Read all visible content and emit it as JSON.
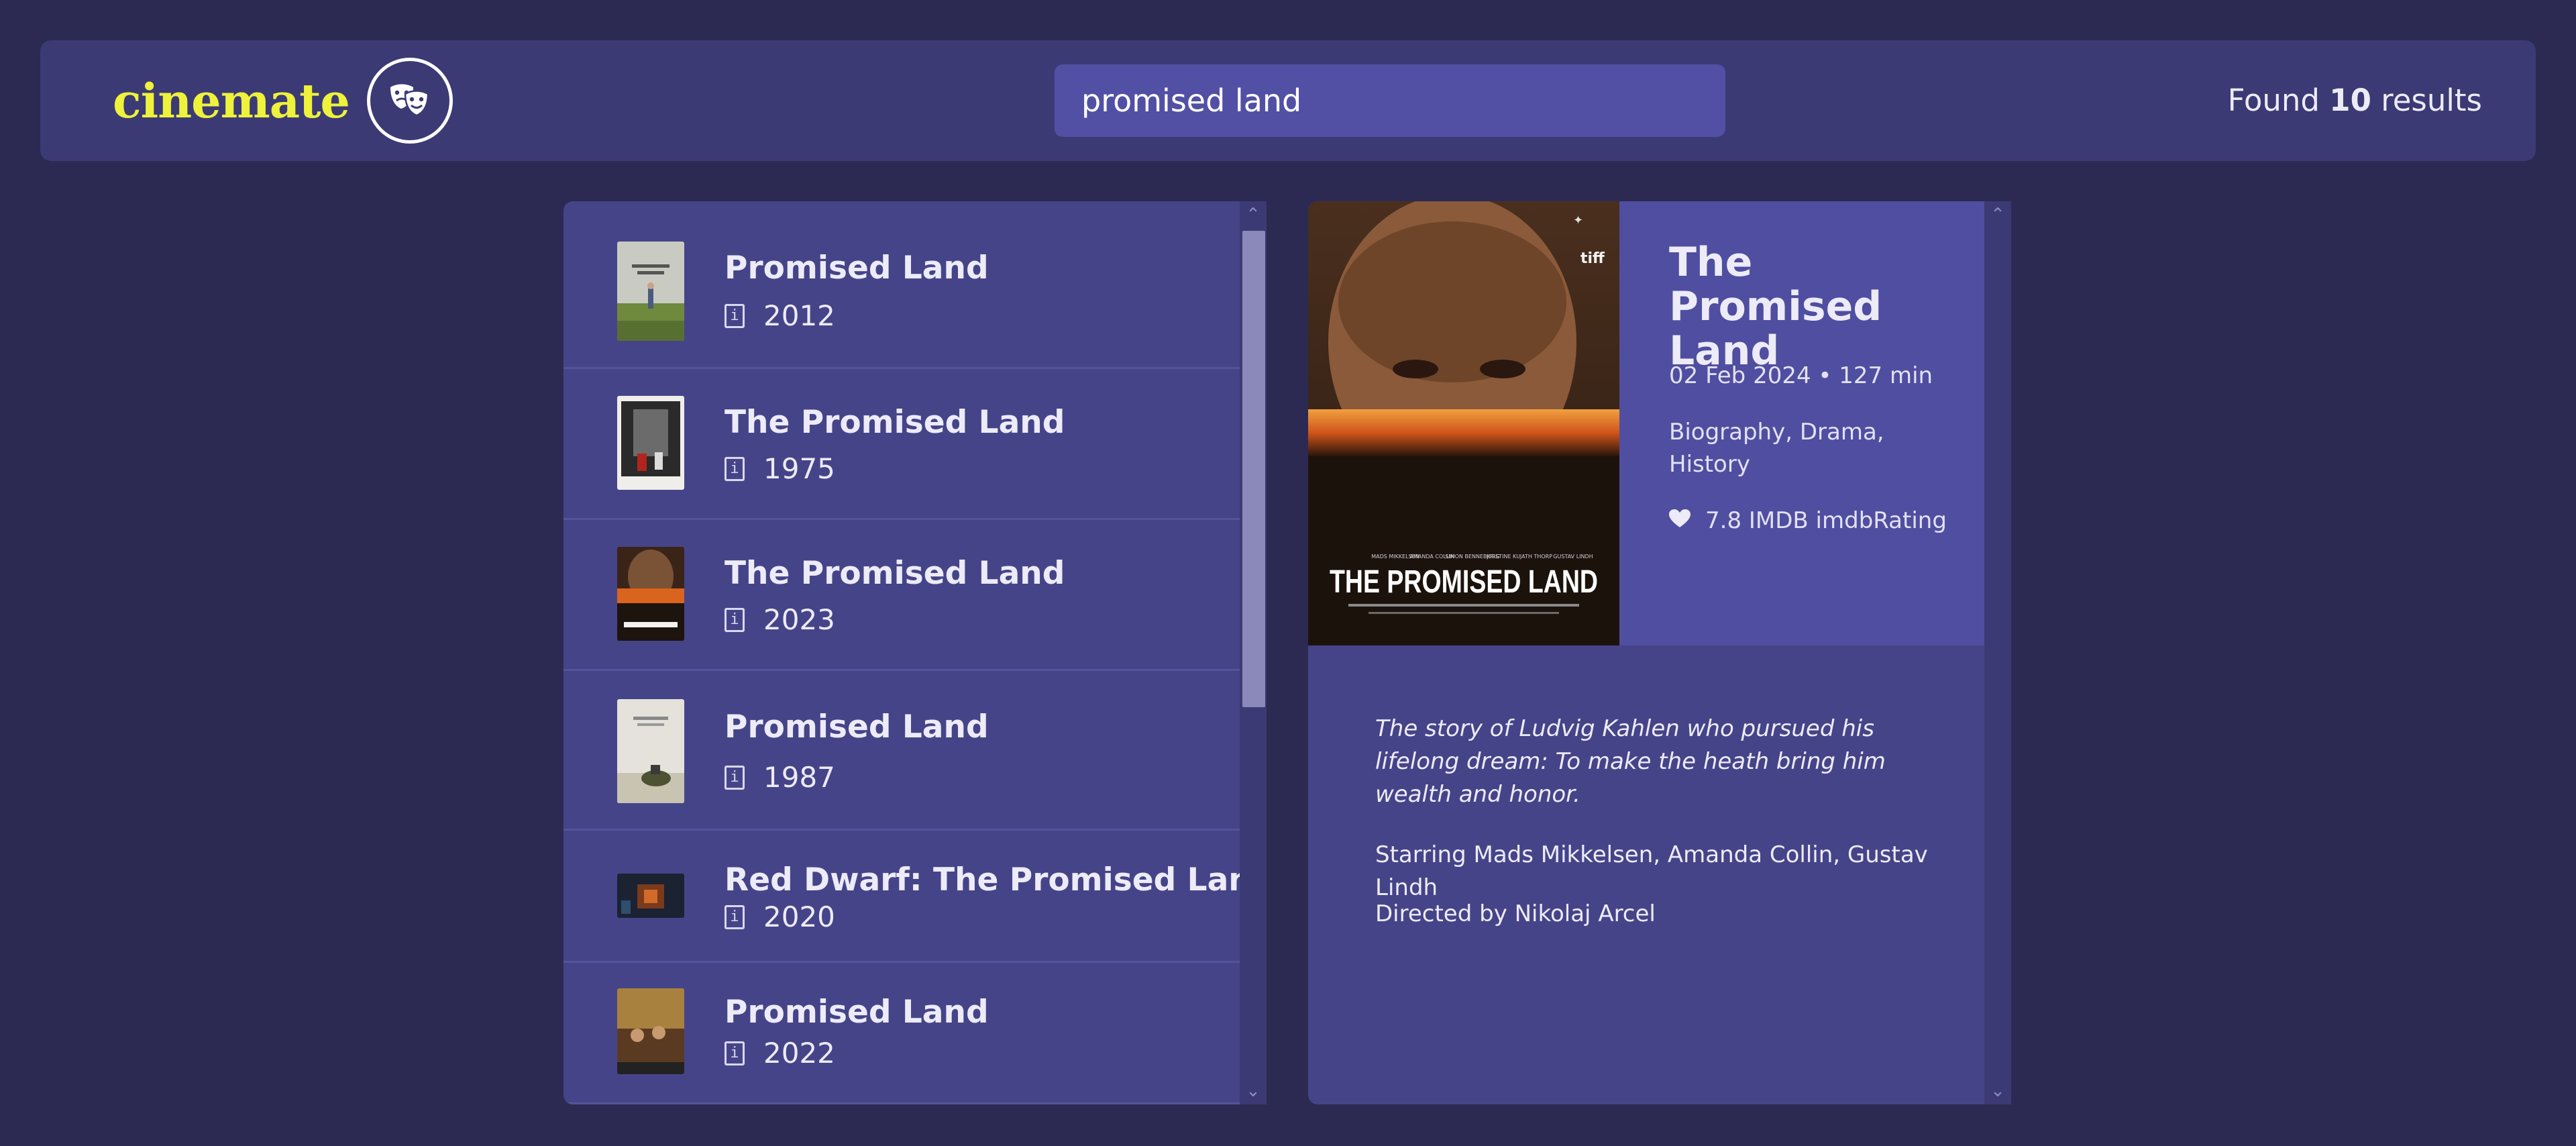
{
  "app": {
    "logo": "cinemate",
    "logo_icon": "theater-masks-icon"
  },
  "search": {
    "value": "promised land"
  },
  "results": {
    "prefix": "Found",
    "count": "10",
    "suffix": "results"
  },
  "list": {
    "items": [
      {
        "title": "Promised Land",
        "year": "2012"
      },
      {
        "title": "The Promised Land",
        "year": "1975"
      },
      {
        "title": "The Promised Land",
        "year": "2023"
      },
      {
        "title": "Promised Land",
        "year": "1987"
      },
      {
        "title": "Red Dwarf: The Promised Land",
        "year": "2020"
      },
      {
        "title": "Promised Land",
        "year": "2022"
      }
    ],
    "info_icon_glyph": "i"
  },
  "detail": {
    "title": "The Promised Land",
    "meta": "02 Feb 2024 • 127 min",
    "genres": "Biography, Drama, History",
    "rating": "7.8 IMDB imdbRating",
    "plot": "The story of Ludvig Kahlen who pursued his lifelong dream: To make the heath bring him wealth and honor.",
    "cast": "Starring Mads Mikkelsen, Amanda Collin, Gustav Lindh",
    "director": "Directed by Nikolaj Arcel",
    "poster": {
      "title_text": "THE PROMISED LAND",
      "cast_names": [
        "MADS MIKKELSEN",
        "AMANDA COLLIN",
        "SIMON BENNEBJERG",
        "KRISTINE KUJATH THORP",
        "GUSTAV LINDH"
      ],
      "badge": "tiff"
    }
  },
  "scrollbar": {
    "up": "⌃",
    "down": "⌄"
  }
}
